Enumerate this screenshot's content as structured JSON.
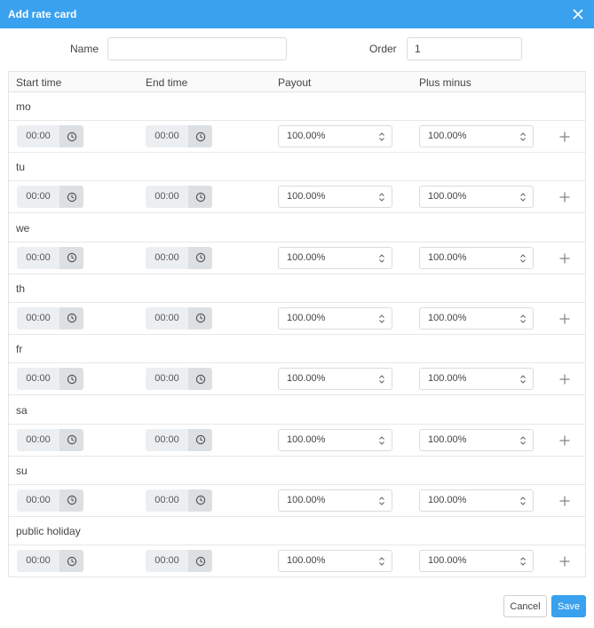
{
  "dialog": {
    "title": "Add rate card",
    "accent": "#3aa1ee",
    "close_icon": "close-icon"
  },
  "form": {
    "name_label": "Name",
    "name_value": "",
    "order_label": "Order",
    "order_value": "1"
  },
  "grid": {
    "headers": [
      "Start time",
      "End time",
      "Payout",
      "Plus minus"
    ],
    "rows": [
      {
        "day": "mo",
        "start": "00:00",
        "end": "00:00",
        "payout": "100.00%",
        "plus_minus": "100.00%"
      },
      {
        "day": "tu",
        "start": "00:00",
        "end": "00:00",
        "payout": "100.00%",
        "plus_minus": "100.00%"
      },
      {
        "day": "we",
        "start": "00:00",
        "end": "00:00",
        "payout": "100.00%",
        "plus_minus": "100.00%"
      },
      {
        "day": "th",
        "start": "00:00",
        "end": "00:00",
        "payout": "100.00%",
        "plus_minus": "100.00%"
      },
      {
        "day": "fr",
        "start": "00:00",
        "end": "00:00",
        "payout": "100.00%",
        "plus_minus": "100.00%"
      },
      {
        "day": "sa",
        "start": "00:00",
        "end": "00:00",
        "payout": "100.00%",
        "plus_minus": "100.00%"
      },
      {
        "day": "su",
        "start": "00:00",
        "end": "00:00",
        "payout": "100.00%",
        "plus_minus": "100.00%"
      },
      {
        "day": "public holiday",
        "start": "00:00",
        "end": "00:00",
        "payout": "100.00%",
        "plus_minus": "100.00%"
      }
    ]
  },
  "footer": {
    "cancel_label": "Cancel",
    "save_label": "Save"
  }
}
